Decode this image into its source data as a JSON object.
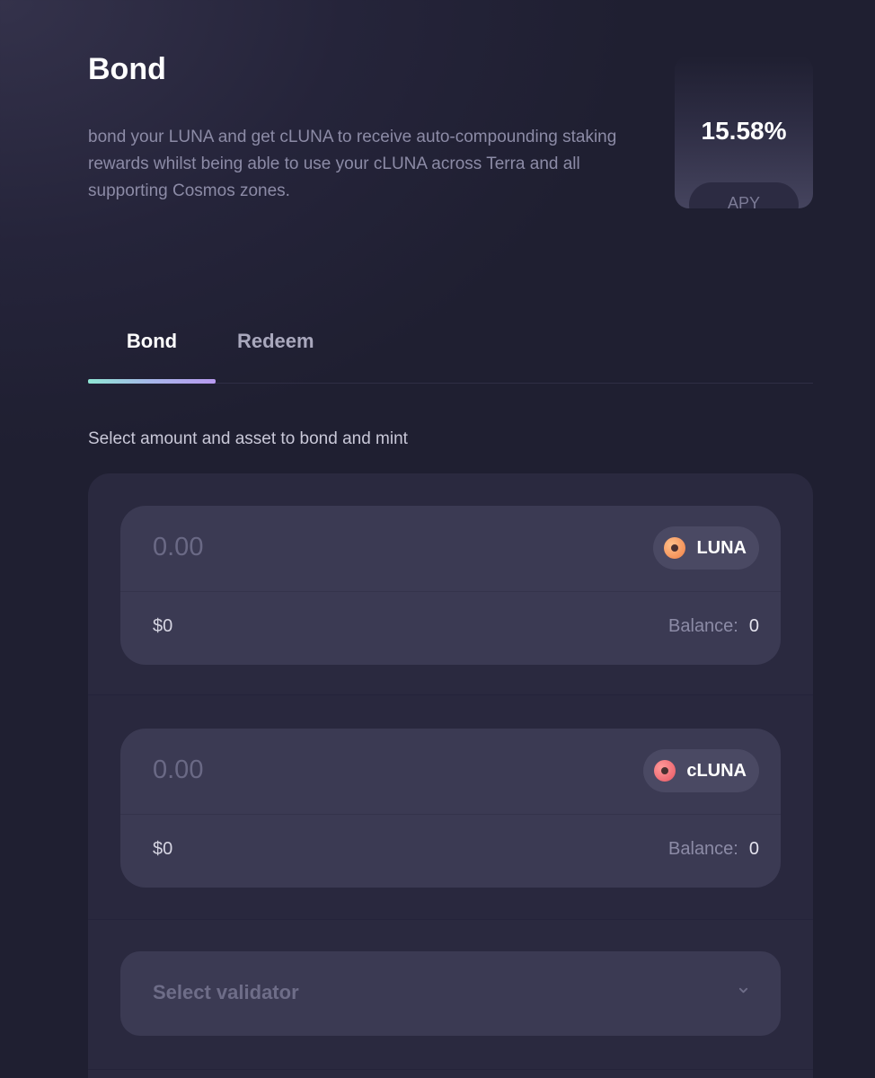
{
  "header": {
    "title": "Bond",
    "description": "bond your LUNA and get cLUNA to receive auto-compounding staking rewards whilst being able to use your cLUNA across Terra and all supporting Cosmos zones."
  },
  "apy": {
    "value": "15.58%",
    "label": "APY"
  },
  "tabs": [
    {
      "label": "Bond",
      "active": true
    },
    {
      "label": "Redeem",
      "active": false
    }
  ],
  "form": {
    "instruction": "Select amount and asset to bond and mint",
    "input_asset": {
      "placeholder": "0.00",
      "token": "LUNA",
      "token_icon": "luna-token-icon",
      "usd_value": "$0",
      "balance_label": "Balance:",
      "balance_value": "0"
    },
    "output_asset": {
      "placeholder": "0.00",
      "token": "cLUNA",
      "token_icon": "cluna-token-icon",
      "usd_value": "$0",
      "balance_label": "Balance:",
      "balance_value": "0"
    },
    "validator": {
      "placeholder": "Select validator",
      "icon": "chevron-down-icon"
    }
  },
  "colors": {
    "background": "#1f1f31",
    "card": "#3b3a53",
    "accent_gradient_start": "#8fe6d4",
    "accent_gradient_end": "#b89af0",
    "luna": "#f5935a",
    "cluna": "#ef6b73"
  }
}
